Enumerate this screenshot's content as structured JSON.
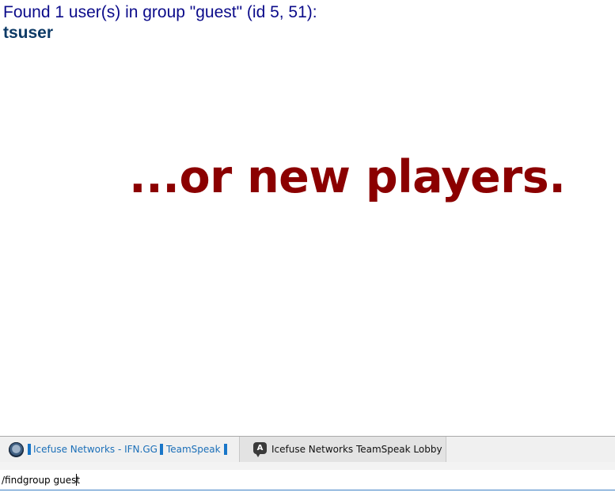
{
  "chat_log": {
    "result_line": "Found 1 user(s) in group \"guest\" (id 5, 51):",
    "user_name": "tsuser",
    "big_message": "...or new players."
  },
  "tabs": {
    "server": {
      "name": "Icefuse Networks - IFN.GG",
      "app": "TeamSpeak",
      "icon": "server-icon"
    },
    "channel": {
      "name": "Icefuse Networks TeamSpeak Lobby",
      "icon_letter": "A",
      "icon": "channel-chat-icon"
    }
  },
  "input": {
    "value": "/findgroup guest"
  },
  "colors": {
    "result_text": "#0b0b8a",
    "user_text": "#0d3a66",
    "big_message": "#8b0000",
    "server_tab_text": "#1b6fb8",
    "server_tab_bar": "#1976c8"
  }
}
